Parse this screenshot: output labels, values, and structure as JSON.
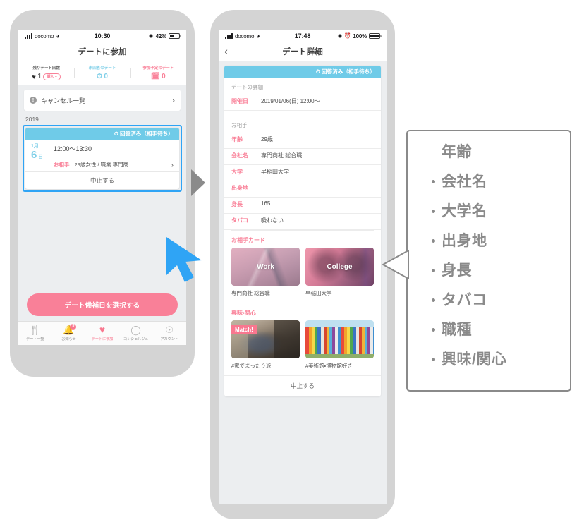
{
  "left_phone": {
    "status_bar": {
      "carrier": "docomo",
      "wifi_icon": "wifi-icon",
      "time": "10:30",
      "location_icon": "location-arrow-icon",
      "battery_text": "42%",
      "battery_level": 42
    },
    "nav": {
      "title": "デートに参加"
    },
    "stats": [
      {
        "label": "残りデート回数",
        "icon": "heart-icon",
        "value": "1",
        "pill": "購入 +",
        "color": "#2b2b2b"
      },
      {
        "label": "未回答のデート",
        "icon": "clock-icon",
        "value": "0",
        "color": "#7fcfe8"
      },
      {
        "label": "参加予定のデート",
        "icon": "calendar-icon",
        "value": "0",
        "color": "#f98098"
      }
    ],
    "cancel_row": {
      "icon": "exclamation-circle-icon",
      "label": "キャンセル一覧",
      "chevron": "chevron-right-icon"
    },
    "year_label": "2019",
    "date_card": {
      "status_icon": "clock-icon",
      "status_text": "回答済み（相手待ち）",
      "month": "1月",
      "day": "6",
      "day_unit": "日",
      "time_range": "12:00〜13:30",
      "partner_label": "お相手",
      "partner_text": "29歳女性 / 職業:専門商…",
      "chevron": "chevron-right-icon",
      "footer_action": "中止する"
    },
    "cta_button": "デート候補日を選択する",
    "tabbar": [
      {
        "icon": "fork-knife-icon",
        "glyph": "🍴",
        "label": "デート一覧",
        "active": false,
        "badge": null
      },
      {
        "icon": "bell-icon",
        "glyph": "🔔",
        "label": "お知らせ",
        "active": false,
        "badge": "3"
      },
      {
        "icon": "heart-icon",
        "glyph": "♥",
        "label": "デートに参加",
        "active": true,
        "badge": null
      },
      {
        "icon": "chat-bubble-icon",
        "glyph": "💬",
        "label": "コンシェルジュ",
        "active": false,
        "badge": null
      },
      {
        "icon": "person-circle-icon",
        "glyph": "👤",
        "label": "アカウント",
        "active": false,
        "badge": null
      }
    ]
  },
  "right_phone": {
    "status_bar": {
      "carrier": "docomo",
      "wifi_icon": "wifi-icon",
      "time": "17:48",
      "location_icon": "location-arrow-icon",
      "alarm_icon": "alarm-icon",
      "battery_text": "100%",
      "battery_level": 100
    },
    "nav": {
      "back_icon": "chevron-left-icon",
      "title": "デート詳細"
    },
    "card_status": {
      "icon": "clock-icon",
      "text": "回答済み（相手待ち）"
    },
    "section_date": {
      "heading": "デートの詳細",
      "rows": [
        {
          "label": "開催日",
          "value": "2019/01/06(日) 12:00〜"
        }
      ]
    },
    "section_partner": {
      "heading": "お相手",
      "rows": [
        {
          "label": "年齢",
          "value": "29歳"
        },
        {
          "label": "会社名",
          "value": "専門商社 総合職"
        },
        {
          "label": "大学",
          "value": "早稲田大学"
        },
        {
          "label": "出身地",
          "value": ""
        },
        {
          "label": "身長",
          "value": "165"
        },
        {
          "label": "タバコ",
          "value": "吸わない"
        }
      ]
    },
    "section_cards": {
      "heading": "お相手カード",
      "items": [
        {
          "overlay_title": "Work",
          "caption": "専門商社 総合職",
          "thumb": "thumb-work",
          "badge": null
        },
        {
          "overlay_title": "College",
          "caption": "早稲田大学",
          "thumb": "thumb-college",
          "badge": null
        }
      ]
    },
    "section_interests": {
      "heading": "興味・関心",
      "items": [
        {
          "overlay_title": "",
          "caption": "#家でまったり派",
          "thumb": "thumb-match",
          "badge": "Match!"
        },
        {
          "overlay_title": "",
          "caption": "#美術館・博物館好き",
          "thumb": "thumb-museum",
          "badge": null
        }
      ]
    },
    "footer_action": "中止する"
  },
  "annotations": {
    "flow_arrow": "triangle-right-icon",
    "cursor": "mouse-cursor-icon",
    "selection_highlight_color": "#2fa4f5",
    "callout": {
      "items": [
        "年齢",
        "会社名",
        "大学名",
        "出身地",
        "身長",
        "タバコ",
        "職種",
        "興味/関心"
      ]
    }
  },
  "colors": {
    "pink": "#f98098",
    "cyan": "#6fcbe8",
    "highlight_blue": "#2fa4f5",
    "frame_gray": "#d4d4d4",
    "screen_bg": "#eceef0",
    "callout_gray": "#8a8a8a"
  }
}
